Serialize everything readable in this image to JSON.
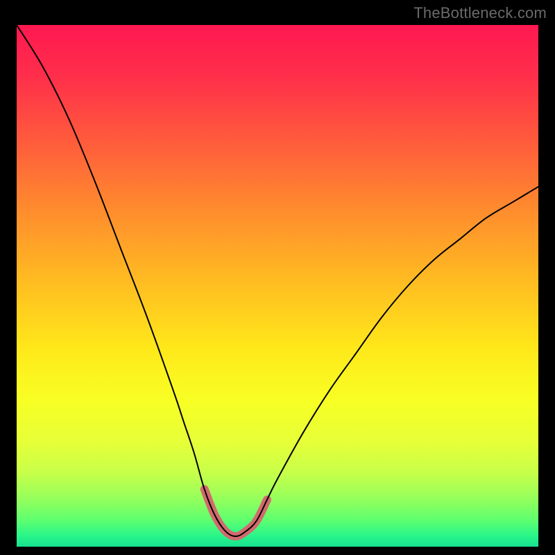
{
  "attribution": "TheBottleneck.com",
  "colors": {
    "page_bg": "#000000",
    "gradient_top": "#ff1851",
    "gradient_mid": "#ffe81a",
    "gradient_bottom": "#17e08f",
    "curve": "#000000",
    "highlight": "#d26a6e"
  },
  "chart_data": {
    "type": "line",
    "title": "",
    "xlabel": "",
    "ylabel": "",
    "xlim": [
      0,
      100
    ],
    "ylim": [
      0,
      100
    ],
    "grid": false,
    "legend": false,
    "note": "V-shaped bottleneck curve. y ≈ 100 at the extremes, dipping to ≈ 2 near x ≈ 42. Highlighted band marks the near-bottom segment between x ≈ 36 and x ≈ 48. No numeric axis labels are shown.",
    "series": [
      {
        "name": "bottleneck_curve",
        "x": [
          0,
          5,
          10,
          15,
          20,
          25,
          30,
          32,
          34,
          36,
          38,
          40,
          42,
          44,
          46,
          48,
          50,
          55,
          60,
          65,
          70,
          75,
          80,
          85,
          90,
          95,
          100
        ],
        "y": [
          100,
          92,
          82,
          70,
          57,
          44,
          30,
          24,
          18,
          11,
          6,
          3,
          2,
          3,
          5,
          9,
          13,
          22,
          30,
          37,
          44,
          50,
          55,
          59,
          63,
          66,
          69
        ]
      },
      {
        "name": "highlight_band",
        "x": [
          36,
          38,
          40,
          42,
          44,
          46,
          48
        ],
        "y": [
          11,
          6,
          3,
          2,
          3,
          5,
          9
        ]
      }
    ],
    "background": "vertical-rainbow-gradient (red→yellow→green)"
  }
}
